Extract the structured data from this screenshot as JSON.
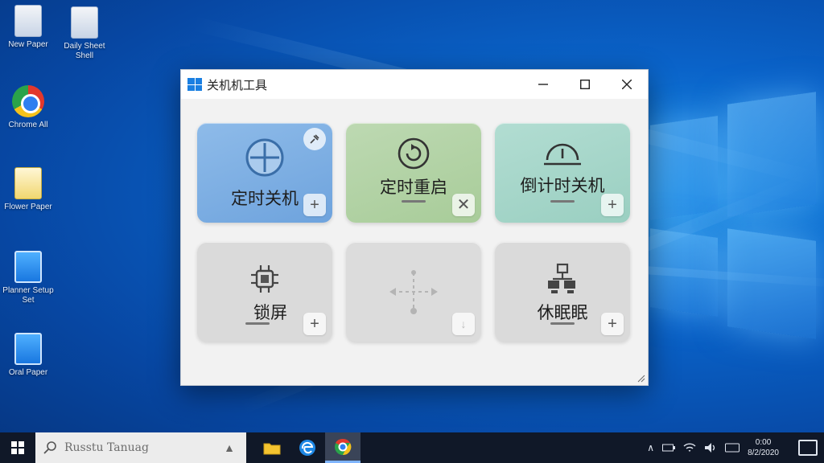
{
  "desktop": {
    "icons": [
      {
        "label": "New Paper",
        "kind": "doc"
      },
      {
        "label": "Daily Sheet Shell",
        "kind": "doc"
      },
      {
        "label": "Chrome All",
        "kind": "chrome"
      },
      {
        "label": "Flower Paper",
        "kind": "docy"
      },
      {
        "label": "Planner Setup Set",
        "kind": "win"
      },
      {
        "label": "Oral Paper",
        "kind": "win"
      }
    ]
  },
  "window": {
    "title": "关机机工具",
    "controls": {
      "minimize": "—",
      "maximize": "☐",
      "close": "✕"
    },
    "cards": [
      {
        "label": "定时关机",
        "icon": "crosshair-icon",
        "color": "#7eb0e4",
        "action": "+",
        "pin": true
      },
      {
        "label": "定时重启",
        "icon": "restart-icon",
        "color": "#b4d4a7",
        "action": "✕",
        "pin": false
      },
      {
        "label": "倒计时关机",
        "icon": "countdown-icon",
        "color": "#a6d6c9",
        "action": "+",
        "pin": false
      },
      {
        "label": "锁屏",
        "icon": "lock-chip-icon",
        "color": "#dadada",
        "action": "+",
        "pin": false
      },
      {
        "label": "",
        "icon": "move-arrows-icon",
        "color": "#dcdcdc",
        "action": "↓",
        "pin": false
      },
      {
        "label": "休眠眠",
        "icon": "sleep-network-icon",
        "color": "#dadada",
        "action": "+",
        "pin": false
      }
    ]
  },
  "taskbar": {
    "search_placeholder": "Russtu Tanuag",
    "search_arrow": "▲",
    "apps": [
      {
        "name": "file-explorer",
        "color": "#f4c430"
      },
      {
        "name": "edge",
        "color": "#1e88e5"
      },
      {
        "name": "chrome",
        "color": "#e1382c"
      }
    ],
    "tray": {
      "chevron": "∧",
      "clock_time": "0:00",
      "clock_date": "8/2/2020"
    }
  }
}
